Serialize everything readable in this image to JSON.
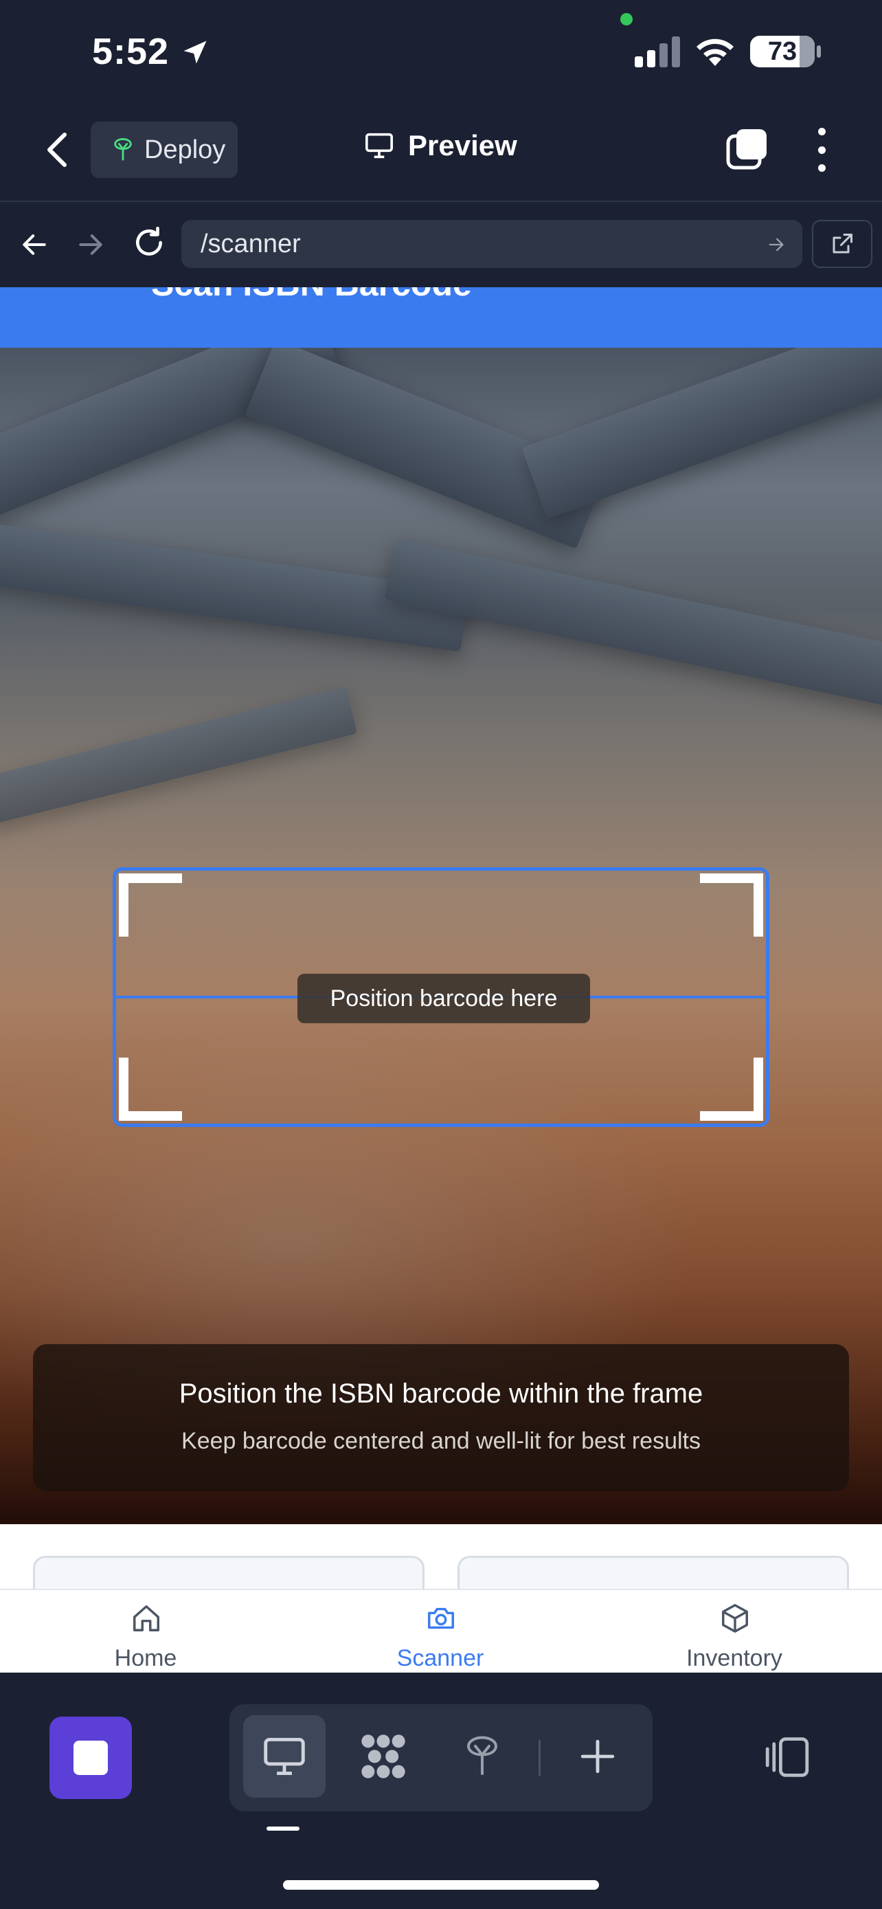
{
  "status_bar": {
    "time": "5:52",
    "battery": "73"
  },
  "header": {
    "deploy_label": "Deploy",
    "title": "Preview"
  },
  "url_bar": {
    "url": "/scanner"
  },
  "page": {
    "title": "Scan ISBN Barcode",
    "frame_label": "Position barcode here",
    "hint_title": "Position the ISBN barcode within the frame",
    "hint_subtitle": "Keep barcode centered and well-lit for best results"
  },
  "tabs": [
    {
      "label": "Home",
      "icon": "home-icon"
    },
    {
      "label": "Scanner",
      "icon": "camera-icon",
      "active": true
    },
    {
      "label": "Inventory",
      "icon": "box-icon"
    }
  ],
  "colors": {
    "accent": "#3b7bf0",
    "chrome": "#1b2132",
    "stop": "#5b3fd6"
  }
}
